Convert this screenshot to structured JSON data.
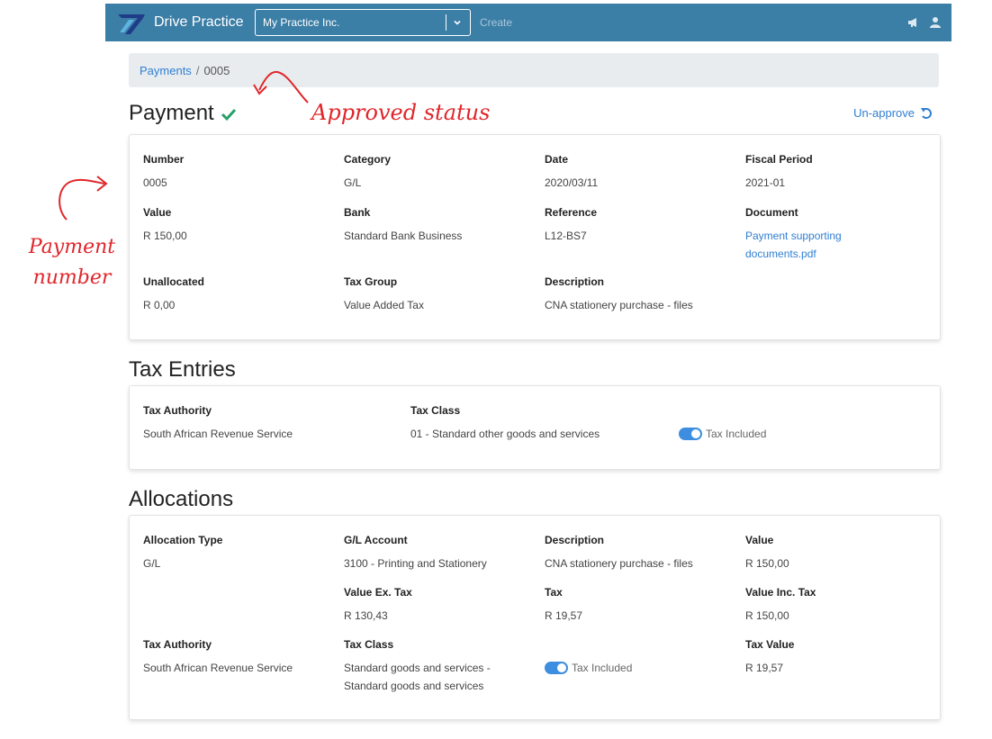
{
  "navbar": {
    "brand": "Drive Practice",
    "company": "My Practice Inc.",
    "create": "Create",
    "icons": [
      "megaphone-icon",
      "user-icon"
    ]
  },
  "breadcrumb": {
    "parent": "Payments",
    "separator": "/",
    "current": "0005"
  },
  "payment": {
    "title": "Payment",
    "status_icon": "check-icon",
    "unapprove": "Un-approve",
    "fields": {
      "number_label": "Number",
      "number": "0005",
      "category_label": "Category",
      "category": "G/L",
      "date_label": "Date",
      "date": "2020/03/11",
      "fiscal_label": "Fiscal Period",
      "fiscal": "2021-01",
      "value_label": "Value",
      "value": "R 150,00",
      "bank_label": "Bank",
      "bank": "Standard Bank Business",
      "reference_label": "Reference",
      "reference": "L12-BS7",
      "document_label": "Document",
      "document_line1": "Payment supporting",
      "document_line2": "documents.pdf",
      "unallocated_label": "Unallocated",
      "unallocated": "R 0,00",
      "taxgroup_label": "Tax Group",
      "taxgroup": "Value Added Tax",
      "description_label": "Description",
      "description": "CNA stationery purchase - files"
    }
  },
  "tax_entries": {
    "title": "Tax Entries",
    "authority_label": "Tax Authority",
    "authority": "South African Revenue Service",
    "class_label": "Tax Class",
    "class": "01 - Standard other goods and services",
    "tax_included_label": "Tax Included",
    "tax_included": true
  },
  "allocations": {
    "title": "Allocations",
    "type_label": "Allocation Type",
    "type": "G/L",
    "account_label": "G/L Account",
    "account": "3100 - Printing and Stationery",
    "description_label": "Description",
    "description": "CNA stationery purchase - files",
    "value_label": "Value",
    "value": "R 150,00",
    "value_ex_label": "Value Ex. Tax",
    "value_ex": "R 130,43",
    "tax_label": "Tax",
    "tax": "R 19,57",
    "value_inc_label": "Value Inc. Tax",
    "value_inc": "R 150,00",
    "authority_label": "Tax Authority",
    "authority": "South African Revenue Service",
    "class_label": "Tax Class",
    "class_line1": "Standard goods and services -",
    "class_line2": "Standard goods and services",
    "tax_included_label": "Tax Included",
    "tax_included": true,
    "tax_value_label": "Tax Value",
    "tax_value": "R 19,57"
  },
  "annotations": {
    "status": "Approved status",
    "number_line1": "Payment",
    "number_line2": "number"
  },
  "colors": {
    "navbar": "#3b7ea6",
    "link": "#2f7fd3",
    "approved": "#28a06a",
    "annotation": "#e0262b"
  }
}
